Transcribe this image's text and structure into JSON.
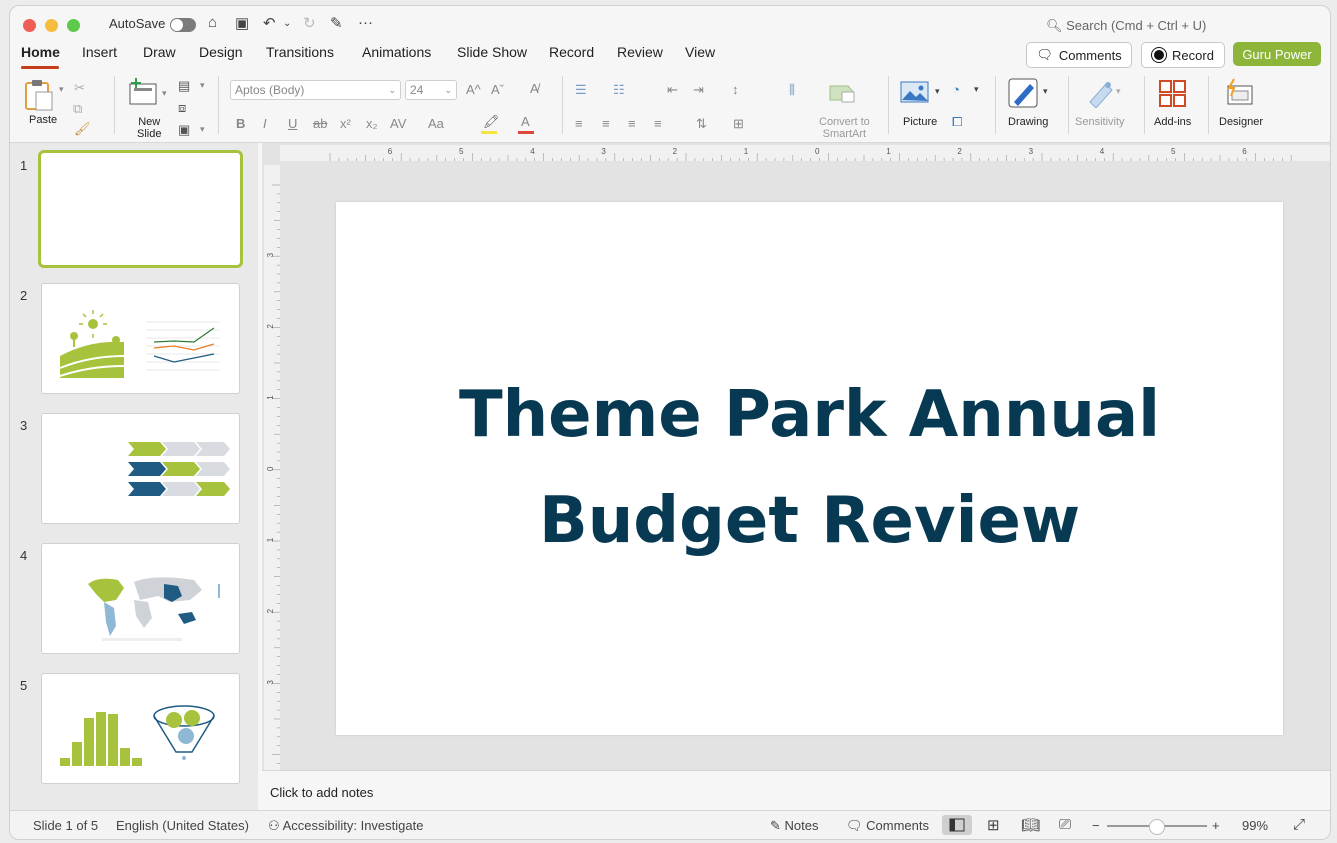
{
  "titlebar": {
    "autosave_label": "AutoSave",
    "search_placeholder": "Search (Cmd + Ctrl + U)",
    "more": "···"
  },
  "tabs": [
    "Home",
    "Insert",
    "Draw",
    "Design",
    "Transitions",
    "Animations",
    "Slide Show",
    "Record",
    "Review",
    "View"
  ],
  "right_buttons": {
    "comments": "Comments",
    "record": "Record",
    "guru": "Guru Power"
  },
  "ribbon": {
    "paste": "Paste",
    "new_slide_1": "New",
    "new_slide_2": "Slide",
    "font_name": "Aptos (Body)",
    "font_size": "24",
    "convert_1": "Convert to",
    "convert_2": "SmartArt",
    "picture": "Picture",
    "drawing": "Drawing",
    "sensitivity": "Sensitivity",
    "addins": "Add-ins",
    "designer": "Designer",
    "bold": "B",
    "italic": "I",
    "underline": "U",
    "strike": "ab",
    "sup": "x²",
    "sub": "x₂",
    "spacing": "AV",
    "case": "Aa",
    "grow": "A^",
    "shrink": "Aˇ"
  },
  "thumbnails": [
    {
      "num": "1"
    },
    {
      "num": "2"
    },
    {
      "num": "3"
    },
    {
      "num": "4"
    },
    {
      "num": "5"
    }
  ],
  "slide": {
    "title_line1": "Theme Park Annual",
    "title_line2": "Budget Review"
  },
  "ruler": {
    "h_labels": [
      "6",
      "5",
      "4",
      "3",
      "2",
      "1",
      "0",
      "1",
      "2",
      "3",
      "4",
      "5",
      "6"
    ],
    "v_labels": [
      "3",
      "2",
      "1",
      "0",
      "1",
      "2",
      "3"
    ]
  },
  "notes_placeholder": "Click to add notes",
  "status": {
    "slide_count": "Slide 1 of 5",
    "language": "English (United States)",
    "accessibility": "Accessibility: Investigate",
    "notes": "Notes",
    "comments": "Comments",
    "zoom": "99%"
  },
  "colors": {
    "accent": "#c43e1c",
    "guru": "#8cb53a",
    "title": "#073a52",
    "thumb_selected": "#a7c23c"
  }
}
